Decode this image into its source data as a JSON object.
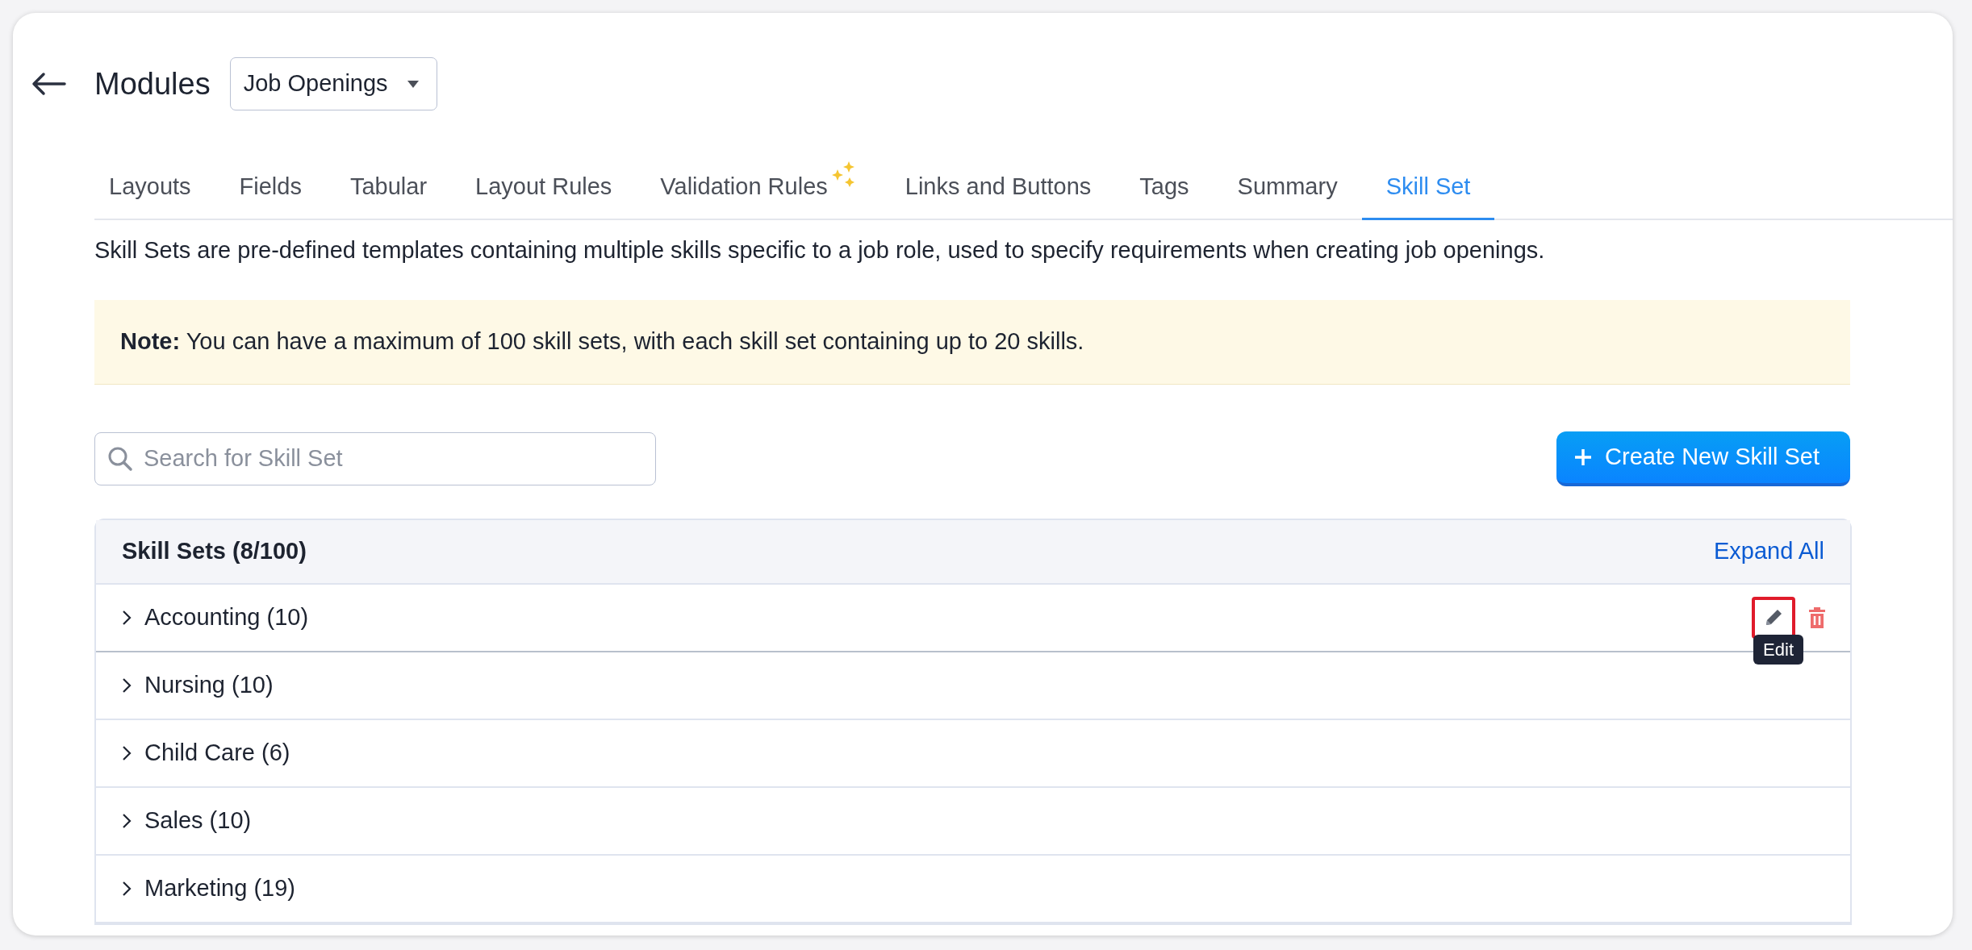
{
  "header": {
    "title": "Modules",
    "module_select": "Job Openings"
  },
  "tabs": [
    {
      "label": "Layouts",
      "selected": false,
      "sparkle": false
    },
    {
      "label": "Fields",
      "selected": false,
      "sparkle": false
    },
    {
      "label": "Tabular",
      "selected": false,
      "sparkle": false
    },
    {
      "label": "Layout Rules",
      "selected": false,
      "sparkle": false
    },
    {
      "label": "Validation Rules",
      "selected": false,
      "sparkle": true
    },
    {
      "label": "Links and Buttons",
      "selected": false,
      "sparkle": false
    },
    {
      "label": "Tags",
      "selected": false,
      "sparkle": false
    },
    {
      "label": "Summary",
      "selected": false,
      "sparkle": false
    },
    {
      "label": "Skill Set",
      "selected": true,
      "sparkle": false
    }
  ],
  "description": "Skill Sets are pre-defined templates containing multiple skills specific to a job role, used to specify requirements when creating job openings.",
  "note": "**Note:** You can have a maximum of 100 skill sets, with each skill set containing up to 20 skills.",
  "search": {
    "placeholder": "Search for Skill Set"
  },
  "create_button": "Create New Skill Set",
  "skill_sets": {
    "title": "Skill Sets (8/100)",
    "expand_all": "Expand All",
    "rows": [
      {
        "label": "Accounting (10)",
        "hovered": true
      },
      {
        "label": "Nursing (10)",
        "hovered": false
      },
      {
        "label": "Child Care (6)",
        "hovered": false
      },
      {
        "label": "Sales (10)",
        "hovered": false
      },
      {
        "label": "Marketing (19)",
        "hovered": false
      }
    ],
    "tooltip": "Edit"
  }
}
